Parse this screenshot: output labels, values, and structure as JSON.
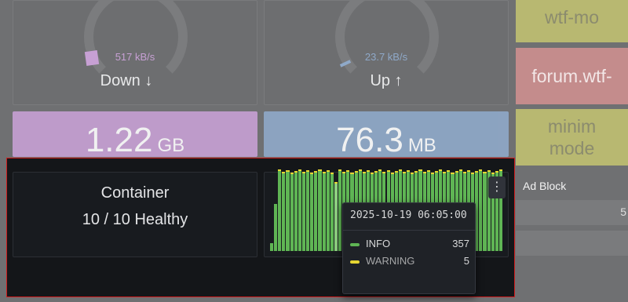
{
  "network": {
    "down": {
      "rate": "517 kB/s",
      "label": "Down ↓",
      "total_value": "1.22",
      "total_unit": "GB",
      "accent": "#c7a0d4"
    },
    "up": {
      "rate": "23.7 kB/s",
      "label": "Up ↑",
      "total_value": "76.3",
      "total_unit": "MB",
      "accent": "#8fa9c9"
    }
  },
  "containers": {
    "title": "Container",
    "status": "10 / 10 Healthy"
  },
  "sidebar": {
    "items": [
      {
        "label": "wtf-mo",
        "bg": "#b8b871"
      },
      {
        "label": "forum.wtf-",
        "bg": "#c48c8c"
      },
      {
        "label": "minim",
        "bg": "#b8b871"
      },
      {
        "label": "mode",
        "bg": "#b8b871"
      }
    ],
    "adblock_label": "Ad Block",
    "adblock_value": "5"
  },
  "logs_chart": {
    "menu_icon": "kebab-menu-icon",
    "tooltip": {
      "time": "2025-10-19 06:05:00",
      "rows": [
        {
          "level": "INFO",
          "value": "357",
          "color": "#5fb554"
        },
        {
          "level": "WARNING",
          "value": "5",
          "color": "#e6d632"
        }
      ]
    }
  }
}
